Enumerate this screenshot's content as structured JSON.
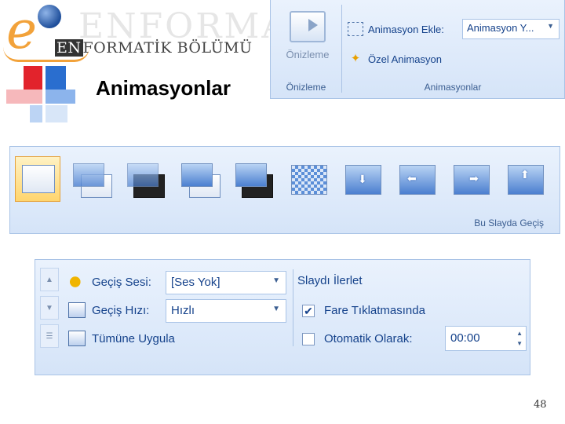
{
  "header": {
    "logo_bg_text": "ENFORMA",
    "logo_letter": "e",
    "logo_sub_prefix": "EN",
    "logo_sub_rest": "FORMATİK BÖLÜMÜ",
    "title": "Animasyonlar"
  },
  "ribbon_animations": {
    "preview_label": "Önizleme",
    "add_animation_label": "Animasyon Ekle:",
    "add_animation_value": "Animasyon Y...",
    "custom_animation_label": "Özel Animasyon",
    "group_preview": "Önizleme",
    "group_animations": "Animasyonlar"
  },
  "ribbon_transitions": {
    "group_label": "Bu Slayda Geçiş",
    "thumbnail_count": 10,
    "selected_index": 0
  },
  "ribbon_settings": {
    "sound_label": "Geçiş Sesi:",
    "sound_value": "[Ses Yok]",
    "speed_label": "Geçiş Hızı:",
    "speed_value": "Hızlı",
    "apply_all_label": "Tümüne Uygula",
    "advance_heading": "Slaydı İlerlet",
    "on_click_label": "Fare Tıklatmasında",
    "on_click_checked": true,
    "auto_label": "Otomatik Olarak:",
    "auto_checked": false,
    "auto_time": "00:00"
  },
  "footer": {
    "page_number": "48"
  },
  "colors": {
    "ribbon_text": "#15428b",
    "ribbon_bg": "#dce8f9",
    "title_text": "#000000"
  }
}
